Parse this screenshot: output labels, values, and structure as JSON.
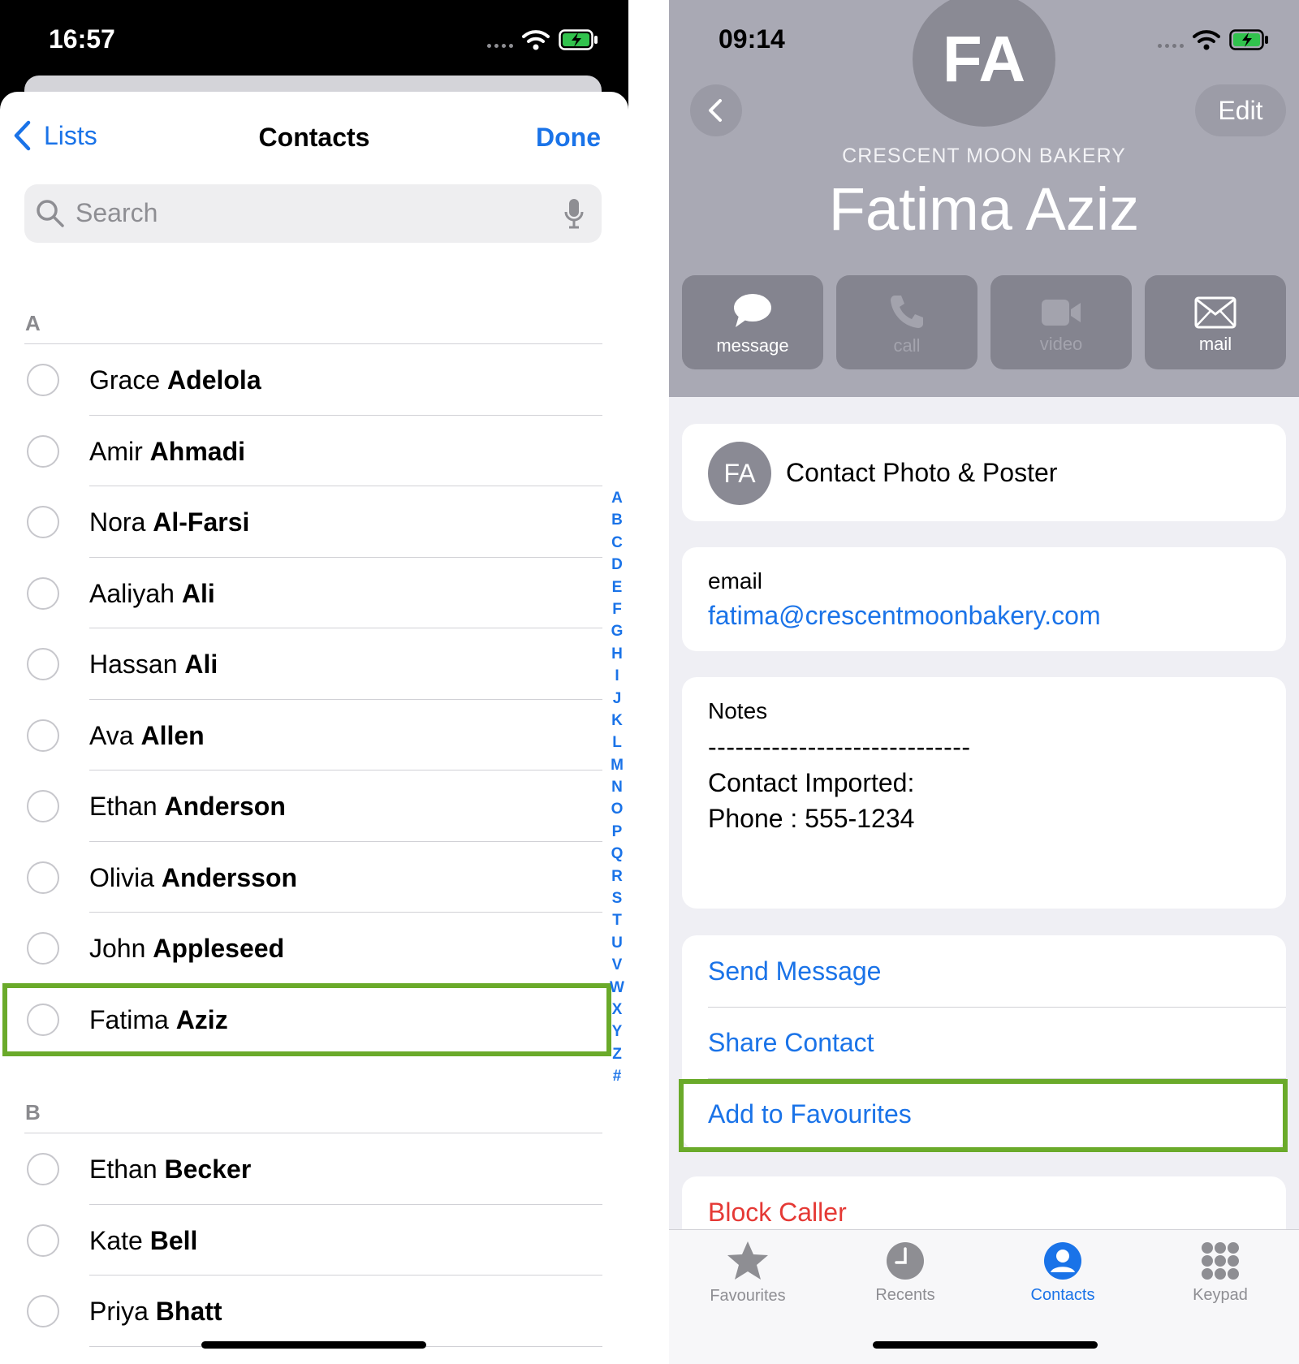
{
  "left": {
    "status": {
      "time": "16:57"
    },
    "nav": {
      "back_label": "Lists",
      "title": "Contacts",
      "done_label": "Done"
    },
    "search": {
      "placeholder": "Search"
    },
    "sections": [
      {
        "letter": "A",
        "contacts": [
          {
            "first": "Grace",
            "last": "Adelola"
          },
          {
            "first": "Amir",
            "last": "Ahmadi"
          },
          {
            "first": "Nora",
            "last": "Al-Farsi"
          },
          {
            "first": "Aaliyah",
            "last": "Ali"
          },
          {
            "first": "Hassan",
            "last": "Ali"
          },
          {
            "first": "Ava",
            "last": "Allen"
          },
          {
            "first": "Ethan",
            "last": "Anderson"
          },
          {
            "first": "Olivia",
            "last": "Andersson"
          },
          {
            "first": "John",
            "last": "Appleseed"
          },
          {
            "first": "Fatima",
            "last": "Aziz"
          }
        ]
      },
      {
        "letter": "B",
        "contacts": [
          {
            "first": "Ethan",
            "last": "Becker"
          },
          {
            "first": "Kate",
            "last": "Bell"
          },
          {
            "first": "Priya",
            "last": "Bhatt"
          }
        ]
      }
    ],
    "index_letters": [
      "A",
      "B",
      "C",
      "D",
      "E",
      "F",
      "G",
      "H",
      "I",
      "J",
      "K",
      "L",
      "M",
      "N",
      "O",
      "P",
      "Q",
      "R",
      "S",
      "T",
      "U",
      "V",
      "W",
      "X",
      "Y",
      "Z",
      "#"
    ]
  },
  "right": {
    "status": {
      "time": "09:14"
    },
    "avatar_initials": "FA",
    "edit_label": "Edit",
    "company": "CRESCENT MOON BAKERY",
    "name": "Fatima Aziz",
    "actions": [
      {
        "label": "message",
        "enabled": true
      },
      {
        "label": "call",
        "enabled": false
      },
      {
        "label": "video",
        "enabled": false
      },
      {
        "label": "mail",
        "enabled": true
      }
    ],
    "photo_poster": {
      "initials": "FA",
      "label": "Contact Photo & Poster"
    },
    "email": {
      "label": "email",
      "value": "fatima@crescentmoonbakery.com"
    },
    "notes": {
      "label": "Notes",
      "line1": "-----------------------------",
      "line2": "Contact Imported:",
      "line3": "Phone : 555-1234"
    },
    "links": {
      "send_message": "Send Message",
      "share_contact": "Share Contact",
      "add_favourites": "Add to Favourites",
      "block_caller": "Block Caller"
    },
    "tabs": [
      {
        "label": "Favourites",
        "icon": "star-icon",
        "active": false
      },
      {
        "label": "Recents",
        "icon": "clock-icon",
        "active": false
      },
      {
        "label": "Contacts",
        "icon": "person-circle-icon",
        "active": true
      },
      {
        "label": "Keypad",
        "icon": "keypad-icon",
        "active": false
      }
    ]
  },
  "colors": {
    "accent": "#1a73e8",
    "highlight": "#6aaa2a",
    "destructive": "#e53935"
  }
}
